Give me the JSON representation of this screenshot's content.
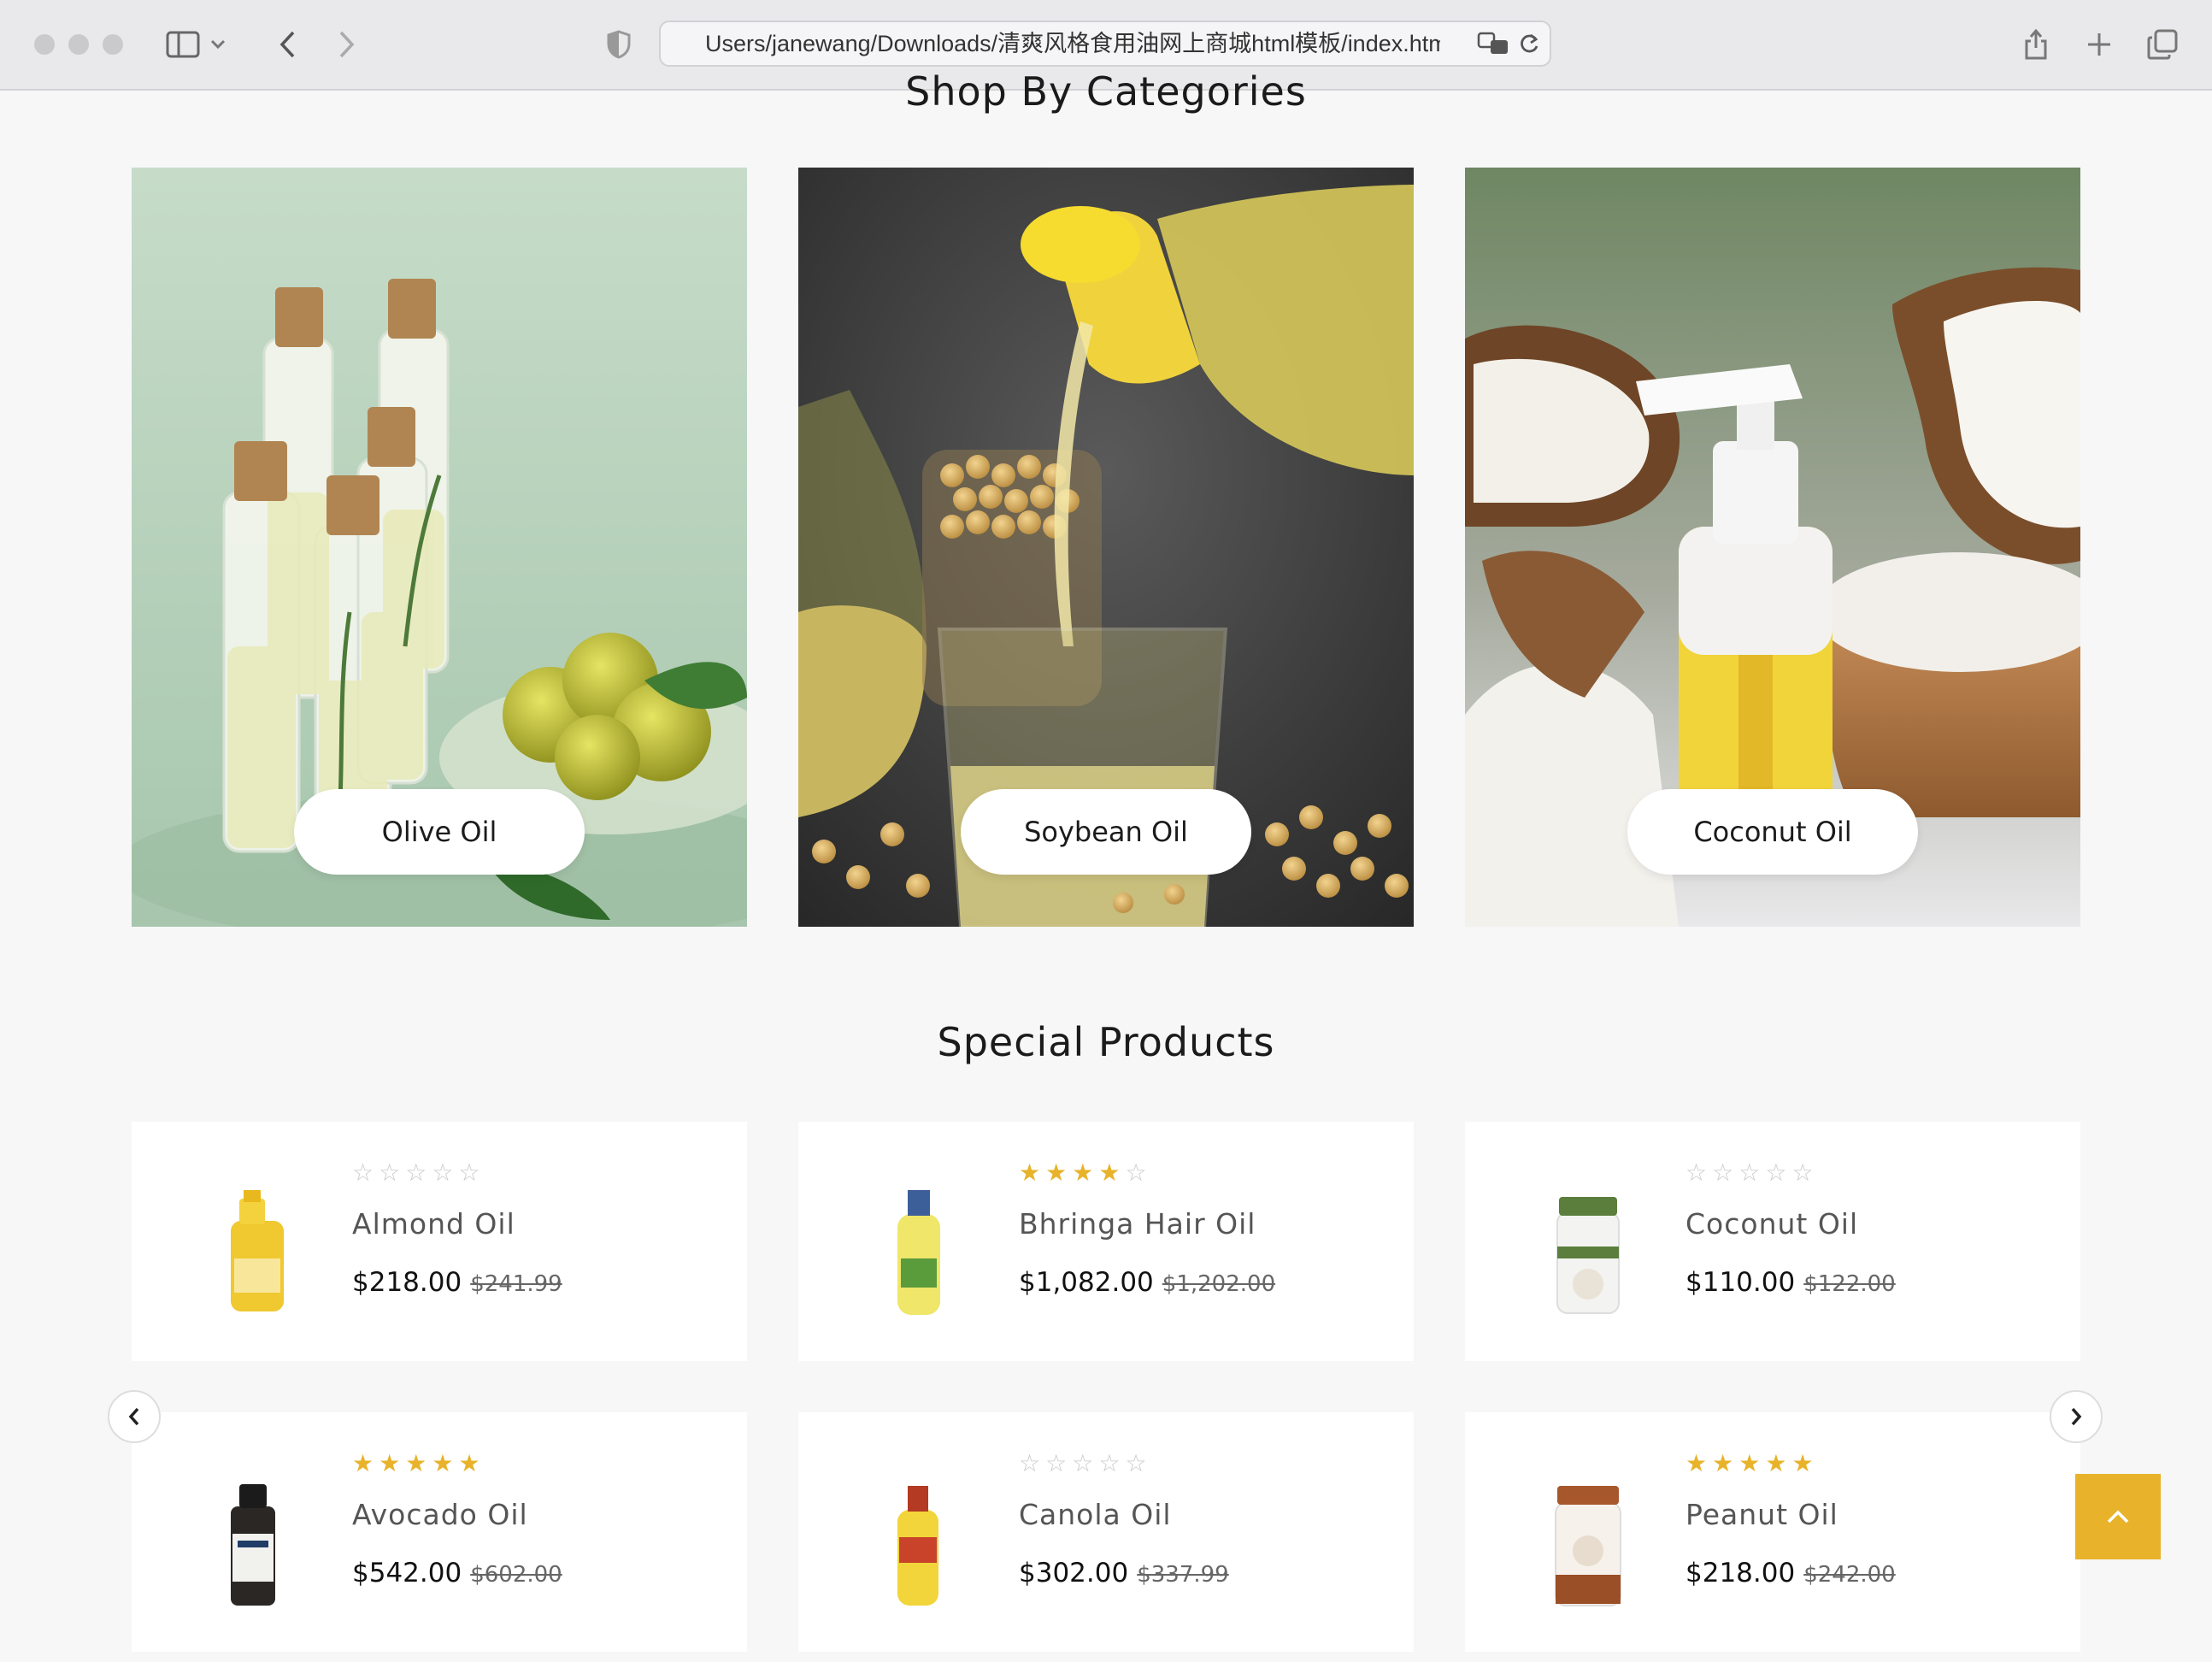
{
  "browser": {
    "url": "Users/janewang/Downloads/清爽风格食用油网上商城html模板/index.html"
  },
  "categories": {
    "title": "Shop By Categories",
    "items": [
      {
        "label": "Olive Oil"
      },
      {
        "label": "Soybean Oil"
      },
      {
        "label": "Coconut Oil"
      }
    ]
  },
  "special": {
    "title": "Special Products",
    "products": [
      {
        "name": "Almond Oil",
        "price": "$218.00",
        "old_price": "$241.99",
        "rating": 0
      },
      {
        "name": "Bhringa Hair Oil",
        "price": "$1,082.00",
        "old_price": "$1,202.00",
        "rating": 4
      },
      {
        "name": "Coconut Oil",
        "price": "$110.00",
        "old_price": "$122.00",
        "rating": 0
      },
      {
        "name": "Avocado Oil",
        "price": "$542.00",
        "old_price": "$602.00",
        "rating": 5
      },
      {
        "name": "Canola Oil",
        "price": "$302.00",
        "old_price": "$337.99",
        "rating": 0
      },
      {
        "name": "Peanut Oil",
        "price": "$218.00",
        "old_price": "$242.00",
        "rating": 5
      }
    ]
  },
  "colors": {
    "accent": "#e8b32a",
    "background": "#f7f7f8"
  },
  "icons": {
    "prev": "chevron-left-icon",
    "next": "chevron-right-icon",
    "to_top": "chevron-up-icon"
  }
}
